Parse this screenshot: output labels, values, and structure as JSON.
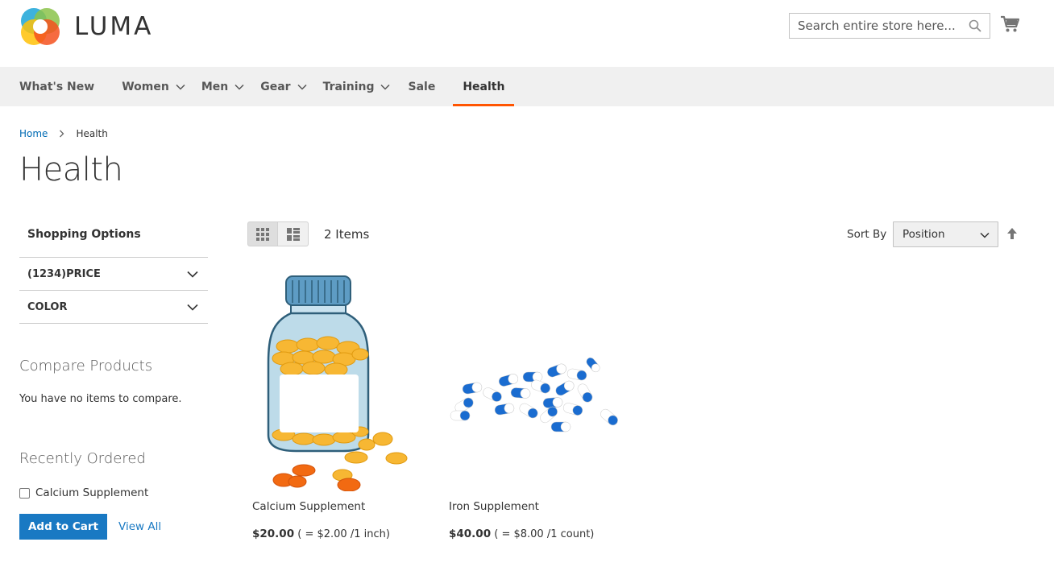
{
  "header": {
    "logo_text": "LUMA",
    "search_placeholder": "Search entire store here...",
    "cart_icon": "cart-icon"
  },
  "nav": {
    "items": [
      {
        "label": "What's New",
        "has_dropdown": false
      },
      {
        "label": "Women",
        "has_dropdown": true
      },
      {
        "label": "Men",
        "has_dropdown": true
      },
      {
        "label": "Gear",
        "has_dropdown": true
      },
      {
        "label": "Training",
        "has_dropdown": true
      },
      {
        "label": "Sale",
        "has_dropdown": false
      },
      {
        "label": "Health",
        "has_dropdown": false,
        "active": true
      }
    ],
    "active_color": "#ff5501"
  },
  "breadcrumb": {
    "home": "Home",
    "current": "Health"
  },
  "page_title": "Health",
  "sidebar": {
    "shopping_options": "Shopping Options",
    "filters": [
      "(1234)PRICE",
      "COLOR"
    ],
    "compare": {
      "title": "Compare Products",
      "empty": "You have no items to compare."
    },
    "recently_ordered": {
      "title": "Recently Ordered",
      "items": [
        "Calcium Supplement"
      ],
      "add_to_cart": "Add to Cart",
      "view_all": "View All"
    }
  },
  "toolbar": {
    "items_count": "2 Items",
    "sort_label": "Sort By",
    "sort_value": "Position"
  },
  "products": [
    {
      "name": "Calcium Supplement",
      "price": "$20.00",
      "unit_price": "( = $2.00 /1 inch)"
    },
    {
      "name": "Iron Supplement",
      "price": "$40.00",
      "unit_price": "( = $8.00 /1 count)"
    }
  ],
  "colors": {
    "link": "#006bb4",
    "button": "#1979c3",
    "nav_bg": "#f0f0f0"
  }
}
